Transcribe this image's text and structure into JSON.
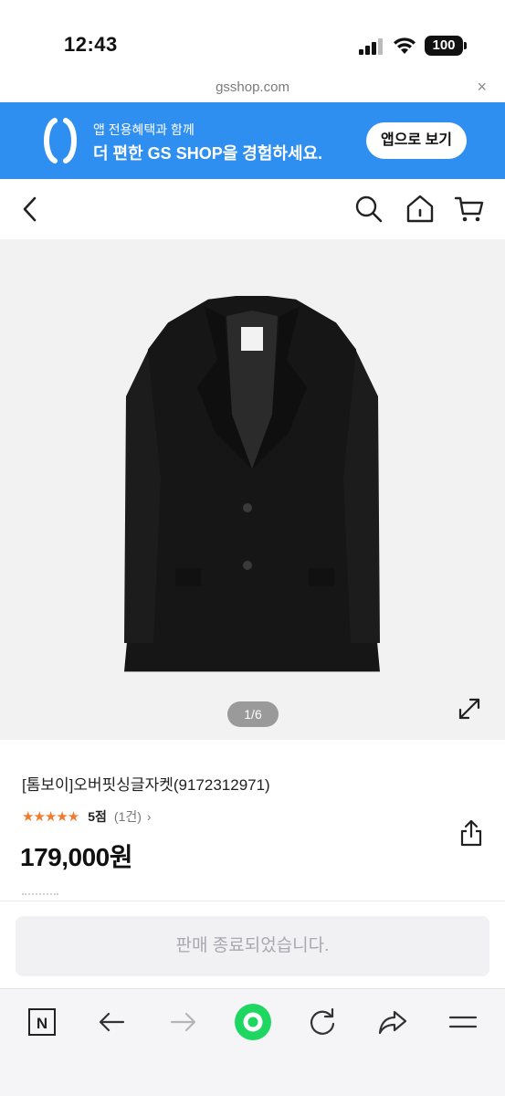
{
  "status_bar": {
    "time": "12:43",
    "battery": "100"
  },
  "browser": {
    "url": "gsshop.com",
    "close_symbol": "×"
  },
  "app_banner": {
    "line1": "앱 전용혜택과 함께",
    "line2": "더 편한 GS SHOP을 경험하세요.",
    "button_label": "앱으로 보기",
    "color": "#2f8ff0"
  },
  "header": {
    "icons": [
      "back-icon",
      "search-icon",
      "home-icon",
      "cart-icon"
    ]
  },
  "product": {
    "image_counter": "1/6",
    "title": "[톰보이]오버핏싱글자켓(9172312971)",
    "stars": "★★★★★",
    "rating_value": 5,
    "score_label": "5점",
    "review_count": "(1건)",
    "review_chevron": "›",
    "price": "179,000원",
    "star_color": "#f07b2d"
  },
  "sold_out": {
    "label": "판매 종료되었습니다."
  },
  "bottom_bar": {
    "nav_badge": "N"
  }
}
